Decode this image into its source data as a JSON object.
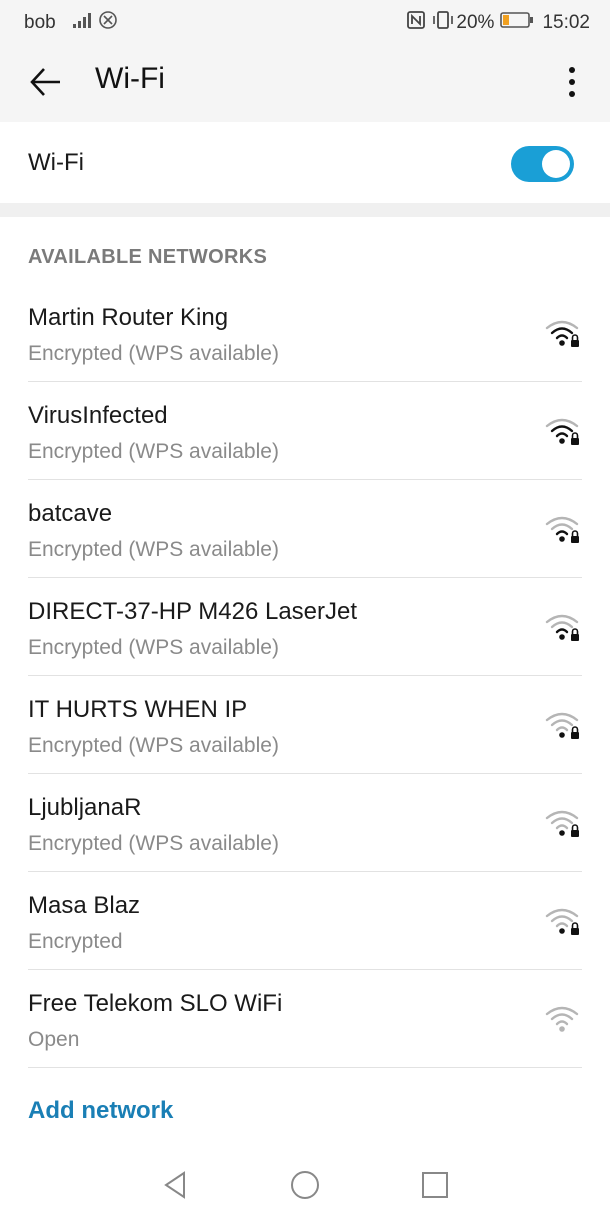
{
  "status_bar": {
    "carrier": "bob",
    "battery_percent": "20%",
    "time": "15:02",
    "icons": [
      "signal-bars-icon",
      "no-sim-icon",
      "nfc-icon",
      "vibrate-icon",
      "battery-icon"
    ]
  },
  "app_bar": {
    "title": "Wi-Fi",
    "back_icon": "arrow-left-icon",
    "menu_icon": "more-vertical-icon"
  },
  "wifi_toggle": {
    "label": "Wi-Fi",
    "enabled": true,
    "accent_color": "#1a9fd6"
  },
  "section": {
    "title": "AVAILABLE NETWORKS"
  },
  "networks": [
    {
      "name": "Martin Router King",
      "status": "Encrypted (WPS available)",
      "signal_bars": 2,
      "locked": true
    },
    {
      "name": "VirusInfected",
      "status": "Encrypted (WPS available)",
      "signal_bars": 2,
      "locked": true
    },
    {
      "name": "batcave",
      "status": "Encrypted (WPS available)",
      "signal_bars": 1,
      "locked": true
    },
    {
      "name": "DIRECT-37-HP M426 LaserJet",
      "status": "Encrypted (WPS available)",
      "signal_bars": 1,
      "locked": true
    },
    {
      "name": "IT HURTS WHEN IP",
      "status": "Encrypted (WPS available)",
      "signal_bars": 0,
      "locked": true
    },
    {
      "name": "LjubljanaR",
      "status": "Encrypted (WPS available)",
      "signal_bars": 0,
      "locked": true
    },
    {
      "name": "Masa Blaz",
      "status": "Encrypted",
      "signal_bars": 0,
      "locked": true
    },
    {
      "name": "Free Telekom SLO WiFi",
      "status": "Open",
      "signal_bars": 0,
      "locked": false
    }
  ],
  "add_network": {
    "label": "Add network",
    "color": "#1a7fb5"
  },
  "nav_bar": {
    "icons": [
      "nav-back-icon",
      "nav-home-icon",
      "nav-recents-icon"
    ]
  }
}
